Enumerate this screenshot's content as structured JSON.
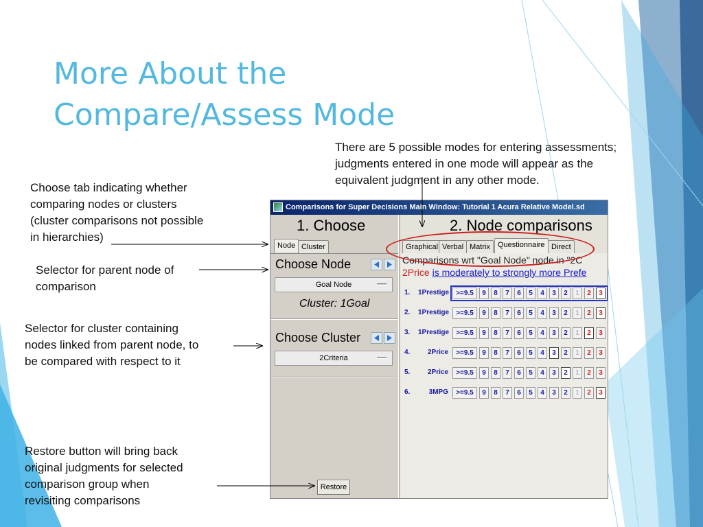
{
  "slide": {
    "title_line1": "More About the",
    "title_line2": "Compare/Assess Mode"
  },
  "notes": {
    "modes": [
      "There are 5 possible modes for entering assessments;",
      "judgments entered in one mode will appear as the",
      "equivalent judgment in any other mode."
    ],
    "tab": [
      "Choose tab indicating whether",
      "comparing nodes or clusters",
      "(cluster comparisons not possible",
      "in hierarchies)"
    ],
    "parent": [
      "Selector for parent node of",
      "comparison"
    ],
    "cluster": [
      "Selector for cluster containing",
      "nodes linked from parent node, to",
      "be compared with respect to it"
    ],
    "restore": [
      "Restore button will bring back",
      "original judgments for selected",
      "comparison group when",
      "revisiting comparisons"
    ]
  },
  "window": {
    "title": "Comparisons for Super Decisions Main Window: Tutorial 1 Acura Relative Model.sd",
    "choose_header": "1. Choose",
    "comparisons_header": "2. Node comparisons",
    "left_tabs": [
      "Node",
      "Cluster"
    ],
    "choose_node_label": "Choose Node",
    "parent_node_value": "Goal Node",
    "cluster_info": "Cluster: 1Goal",
    "choose_cluster_label": "Choose Cluster",
    "cluster_value": "2Criteria",
    "restore_label": "Restore",
    "mode_tabs": [
      "Graphical",
      "Verbal",
      "Matrix",
      "Questionnaire",
      "Direct"
    ],
    "active_mode": "Questionnaire",
    "comparison_line": "Comparisons wrt \"Goal Node\" node in \"2C",
    "comparison_subject": "2Price",
    "comparison_verdict": "is moderately to strongly more Prefe",
    "scale": [
      ">=9.5",
      "9",
      "8",
      "7",
      "6",
      "5",
      "4",
      "3",
      "2",
      "1",
      "2",
      "3"
    ],
    "rows": [
      {
        "num": "1.",
        "node": "1Prestige",
        "selected": "3R"
      },
      {
        "num": "2.",
        "node": "1Prestige",
        "selected": "3R"
      },
      {
        "num": "3.",
        "node": "1Prestige",
        "selected": "2R"
      },
      {
        "num": "4.",
        "node": "2Price",
        "selected": "3L"
      },
      {
        "num": "5.",
        "node": "2Price",
        "selected": "2L"
      },
      {
        "num": "6.",
        "node": "3MPG",
        "selected": "3R"
      }
    ]
  },
  "colors": {
    "title": "#53b8e0",
    "highlight_oval": "#c82020",
    "row_text": "#1a1aa0",
    "accent_red": "#d02020"
  }
}
